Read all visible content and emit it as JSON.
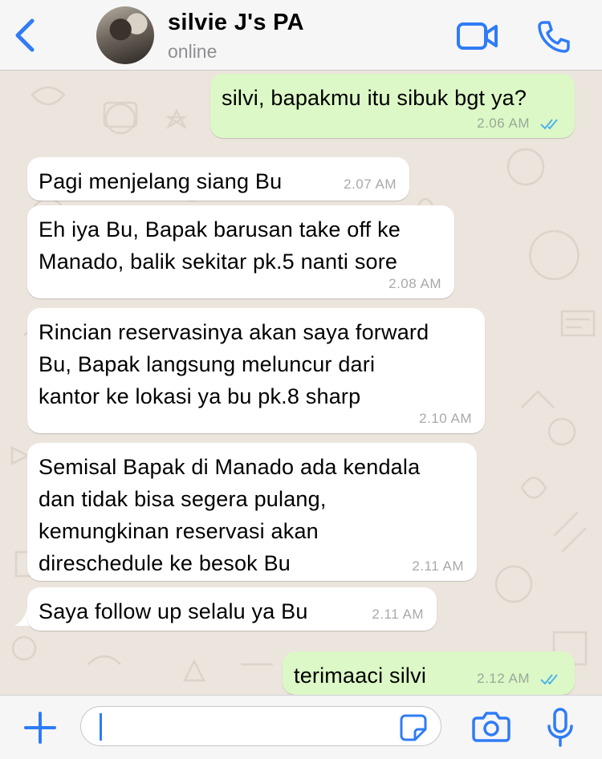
{
  "header": {
    "contact_name": "silvie J's PA",
    "status": "online",
    "icons": [
      "chevron-left-icon",
      "avatar",
      "video-camera-icon",
      "phone-icon"
    ]
  },
  "messages": [
    {
      "direction": "outgoing",
      "text": "silvi, bapakmu itu sibuk bgt ya?",
      "time": "2.06 AM",
      "status": "read"
    },
    {
      "direction": "incoming",
      "text": "Pagi menjelang siang Bu",
      "time": "2.07 AM"
    },
    {
      "direction": "incoming",
      "text": "Eh iya Bu, Bapak barusan take off ke\nManado, balik sekitar pk.5 nanti sore",
      "time": "2.08 AM"
    },
    {
      "direction": "incoming",
      "text": "Rincian reservasinya akan saya forward\nBu, Bapak langsung meluncur dari\nkantor ke lokasi ya bu pk.8 sharp",
      "time": "2.10 AM"
    },
    {
      "direction": "incoming",
      "text": "Semisal Bapak di Manado ada kendala\ndan tidak bisa segera pulang,\nkemungkinan reservasi akan\ndireschedule ke besok Bu",
      "time": "2.11 AM"
    },
    {
      "direction": "incoming",
      "text": "Saya follow up selalu ya Bu",
      "time": "2.11 AM"
    },
    {
      "direction": "outgoing",
      "text": "terimaaci silvi",
      "time": "2.12 AM",
      "status": "read"
    }
  ],
  "composer": {
    "input_value": "",
    "icons": [
      "plus-icon",
      "sticker-icon",
      "camera-icon",
      "microphone-icon"
    ]
  },
  "colors": {
    "accent": "#2f7cf6",
    "outgoing_bubble": "#dcf8c6",
    "incoming_bubble": "#ffffff",
    "chat_background": "#ece5dd",
    "read_ticks": "#4fb3e8"
  }
}
